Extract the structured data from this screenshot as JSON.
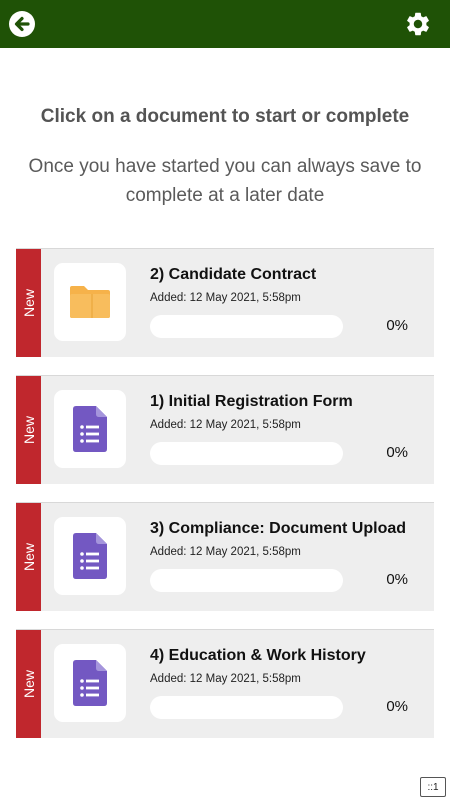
{
  "header": {
    "back_icon": "back-arrow-circle-icon",
    "settings_icon": "gear-icon",
    "bar_color": "#1f5206"
  },
  "intro": {
    "title": "Click on a document to start or complete",
    "subtitle": "Once you have started you can always save to complete at a later date"
  },
  "documents": [
    {
      "badge": "New",
      "icon": "folder-icon",
      "title": "2) Candidate Contract",
      "added": "Added: 12 May 2021, 5:58pm",
      "progress": 0,
      "progress_label": "0%"
    },
    {
      "badge": "New",
      "icon": "form-document-icon",
      "title": "1) Initial Registration Form",
      "added": "Added: 12 May 2021, 5:58pm",
      "progress": 0,
      "progress_label": "0%"
    },
    {
      "badge": "New",
      "icon": "form-document-icon",
      "title": "3) Compliance: Document Upload",
      "added": "Added: 12 May 2021, 5:58pm",
      "progress": 0,
      "progress_label": "0%"
    },
    {
      "badge": "New",
      "icon": "form-document-icon",
      "title": "4) Education & Work History",
      "added": "Added: 12 May 2021, 5:58pm",
      "progress": 0,
      "progress_label": "0%"
    }
  ],
  "corner_label": "::1",
  "colors": {
    "accent": "#1f5206",
    "badge": "#c0272d",
    "folder": "#f6b24a",
    "form": "#7358c2"
  }
}
